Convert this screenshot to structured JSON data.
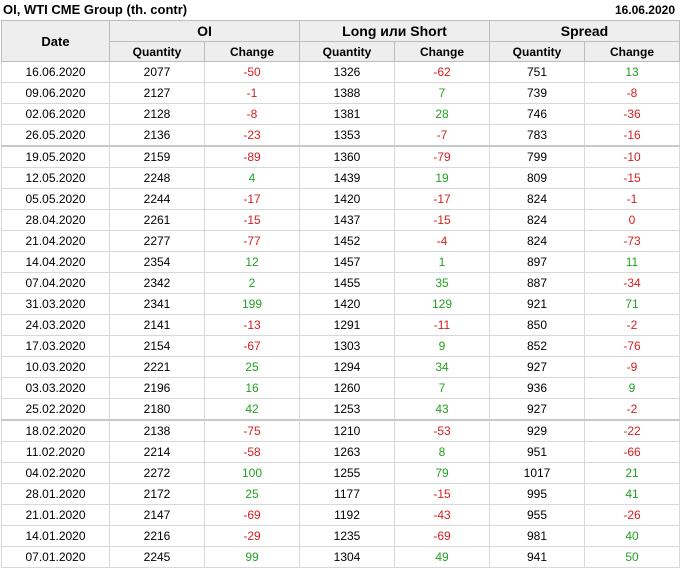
{
  "header": {
    "title": "OI, WTI CME Group (th. contr)",
    "date": "16.06.2020"
  },
  "columns": {
    "date": "Date",
    "groups": [
      "OI",
      "Long или Short",
      "Spread"
    ],
    "quantity": "Quantity",
    "change": "Change"
  },
  "colors": {
    "negative": "#d32020",
    "positive": "#23a023"
  },
  "rows": [
    [
      "16.06.2020",
      "2077",
      "-50",
      "1326",
      "-62",
      "751",
      "13"
    ],
    [
      "09.06.2020",
      "2127",
      "-1",
      "1388",
      "7",
      "739",
      "-8"
    ],
    [
      "02.06.2020",
      "2128",
      "-8",
      "1381",
      "28",
      "746",
      "-36"
    ],
    [
      "26.05.2020",
      "2136",
      "-23",
      "1353",
      "-7",
      "783",
      "-16"
    ],
    [
      "19.05.2020",
      "2159",
      "-89",
      "1360",
      "-79",
      "799",
      "-10"
    ],
    [
      "12.05.2020",
      "2248",
      "4",
      "1439",
      "19",
      "809",
      "-15"
    ],
    [
      "05.05.2020",
      "2244",
      "-17",
      "1420",
      "-17",
      "824",
      "-1"
    ],
    [
      "28.04.2020",
      "2261",
      "-15",
      "1437",
      "-15",
      "824",
      "0"
    ],
    [
      "21.04.2020",
      "2277",
      "-77",
      "1452",
      "-4",
      "824",
      "-73"
    ],
    [
      "14.04.2020",
      "2354",
      "12",
      "1457",
      "1",
      "897",
      "11"
    ],
    [
      "07.04.2020",
      "2342",
      "2",
      "1455",
      "35",
      "887",
      "-34"
    ],
    [
      "31.03.2020",
      "2341",
      "199",
      "1420",
      "129",
      "921",
      "71"
    ],
    [
      "24.03.2020",
      "2141",
      "-13",
      "1291",
      "-11",
      "850",
      "-2"
    ],
    [
      "17.03.2020",
      "2154",
      "-67",
      "1303",
      "9",
      "852",
      "-76"
    ],
    [
      "10.03.2020",
      "2221",
      "25",
      "1294",
      "34",
      "927",
      "-9"
    ],
    [
      "03.03.2020",
      "2196",
      "16",
      "1260",
      "7",
      "936",
      "9"
    ],
    [
      "25.02.2020",
      "2180",
      "42",
      "1253",
      "43",
      "927",
      "-2"
    ],
    [
      "18.02.2020",
      "2138",
      "-75",
      "1210",
      "-53",
      "929",
      "-22"
    ],
    [
      "11.02.2020",
      "2214",
      "-58",
      "1263",
      "8",
      "951",
      "-66"
    ],
    [
      "04.02.2020",
      "2272",
      "100",
      "1255",
      "79",
      "1017",
      "21"
    ],
    [
      "28.01.2020",
      "2172",
      "25",
      "1177",
      "-15",
      "995",
      "41"
    ],
    [
      "21.01.2020",
      "2147",
      "-69",
      "1192",
      "-43",
      "955",
      "-26"
    ],
    [
      "14.01.2020",
      "2216",
      "-29",
      "1235",
      "-69",
      "981",
      "40"
    ],
    [
      "07.01.2020",
      "2245",
      "99",
      "1304",
      "49",
      "941",
      "50"
    ]
  ]
}
